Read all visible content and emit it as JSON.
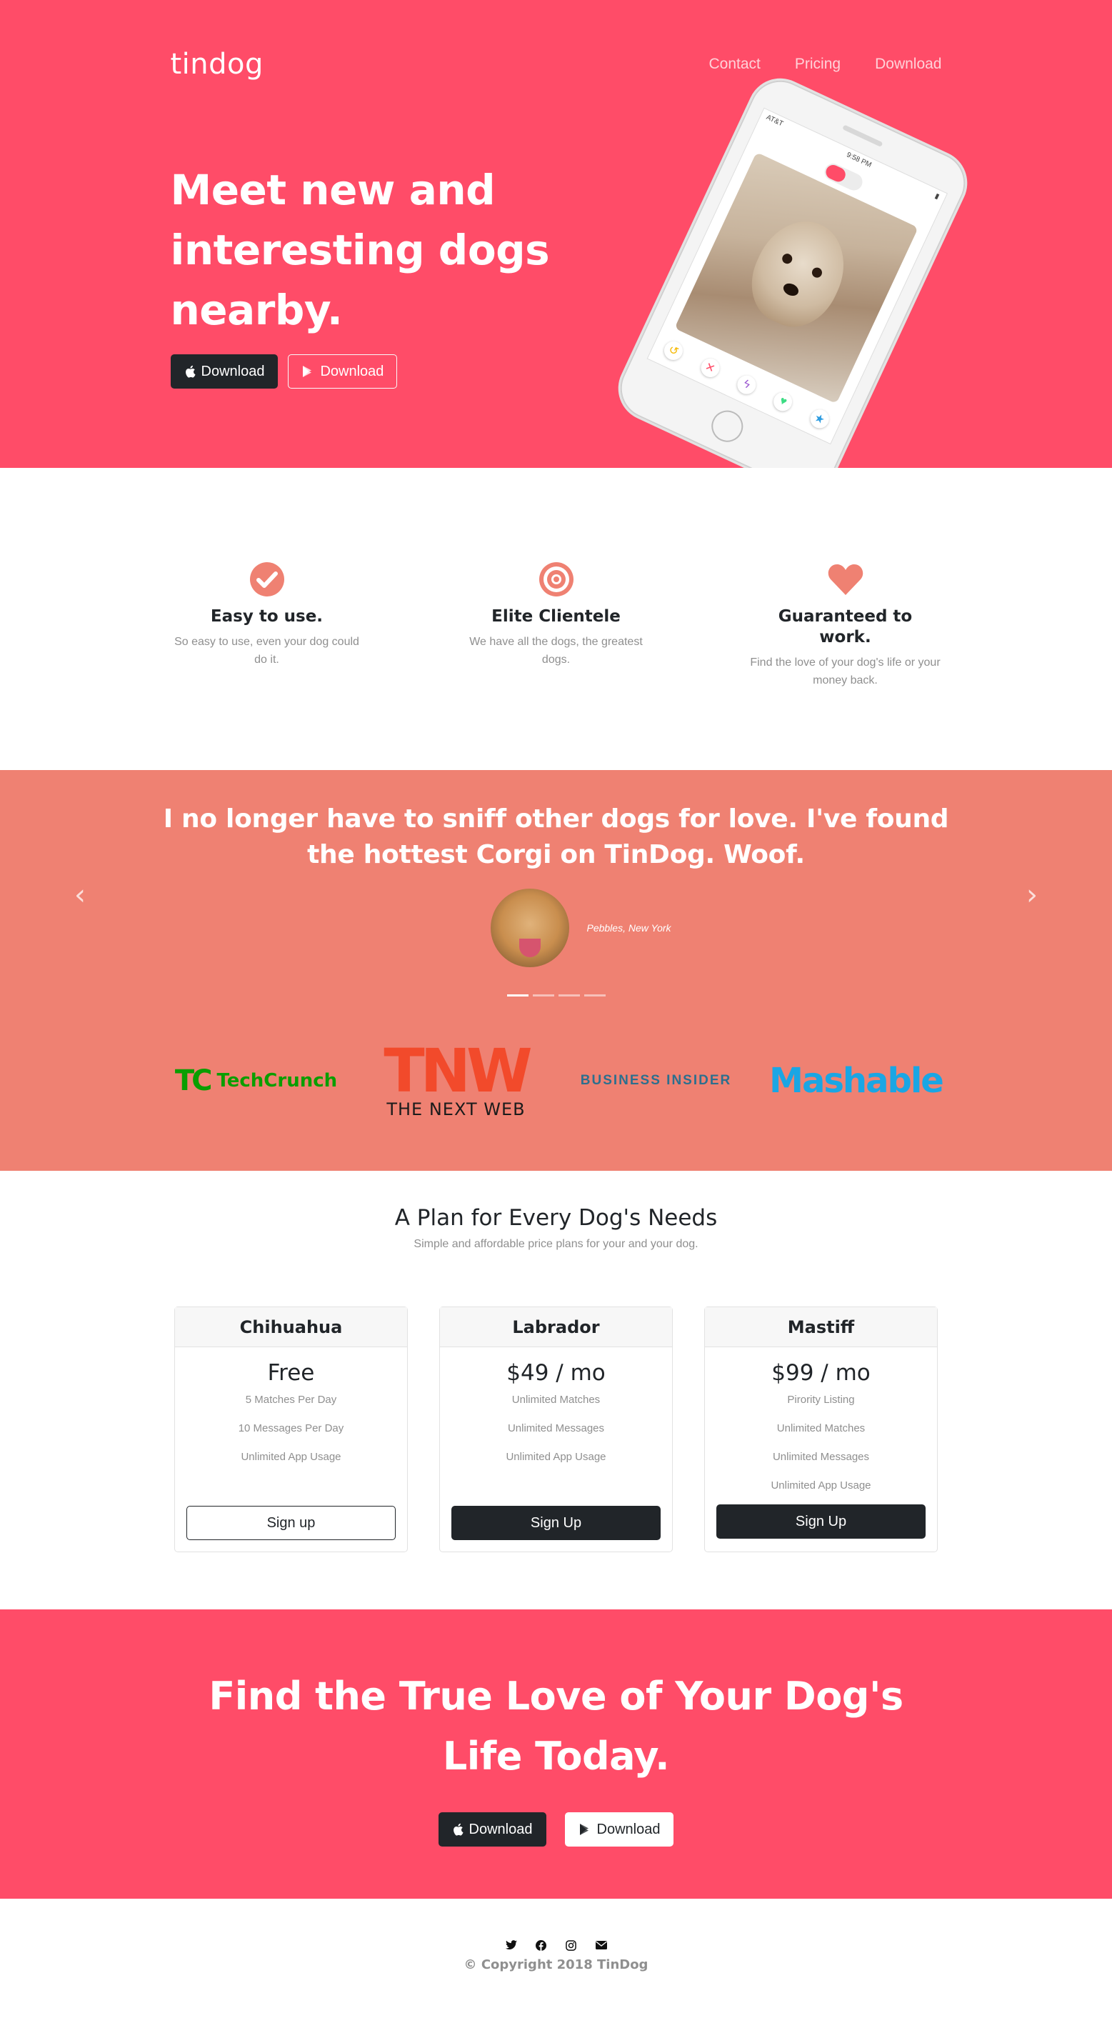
{
  "navbar": {
    "brand": "tindog",
    "links": [
      "Contact",
      "Pricing",
      "Download"
    ]
  },
  "hero": {
    "heading": "Meet new and interesting dogs nearby.",
    "buttons": [
      {
        "label": "Download",
        "icon": "apple-icon"
      },
      {
        "label": "Download",
        "icon": "google-play-icon"
      }
    ],
    "phone": {
      "status_time": "9:58 PM",
      "carrier": "AT&T"
    }
  },
  "features": [
    {
      "icon": "check-circle-icon",
      "title": "Easy to use.",
      "text": "So easy to use, even your dog could do it."
    },
    {
      "icon": "bullseye-icon",
      "title": "Elite Clientele",
      "text": "We have all the dogs, the greatest dogs."
    },
    {
      "icon": "heart-icon",
      "title": "Guaranteed to work.",
      "text": "Find the love of your dog's life or your money back."
    }
  ],
  "testimonial": {
    "quote": "I no longer have to sniff other dogs for love. I've found the hottest Corgi on TinDog. Woof.",
    "author": "Pebbles, New York",
    "indicators": 4,
    "active_indicator": 0
  },
  "press": {
    "techcrunch": {
      "mark": "TC",
      "text": "TechCrunch"
    },
    "tnw": {
      "mark": "TNW",
      "text": "THE NEXT WEB"
    },
    "business_insider": "BUSINESS INSIDER",
    "mashable": "Mashable"
  },
  "pricing": {
    "heading": "A Plan for Every Dog's Needs",
    "subheading": "Simple and affordable price plans for your and your dog.",
    "plans": [
      {
        "name": "Chihuahua",
        "price": "Free",
        "features": [
          "5 Matches Per Day",
          "10 Messages Per Day",
          "Unlimited App Usage"
        ],
        "button": "Sign up"
      },
      {
        "name": "Labrador",
        "price": "$49 / mo",
        "features": [
          "Unlimited Matches",
          "Unlimited Messages",
          "Unlimited App Usage"
        ],
        "button": "Sign Up"
      },
      {
        "name": "Mastiff",
        "price": "$99 / mo",
        "features": [
          "Pirority Listing",
          "Unlimited Matches",
          "Unlimited Messages",
          "Unlimited App Usage"
        ],
        "button": "Sign Up"
      }
    ]
  },
  "cta": {
    "heading": "Find the True Love of Your Dog's Life Today.",
    "buttons": [
      {
        "label": "Download",
        "icon": "apple-icon"
      },
      {
        "label": "Download",
        "icon": "google-play-icon"
      }
    ]
  },
  "footer": {
    "social_icons": [
      "twitter-icon",
      "facebook-icon",
      "instagram-icon",
      "envelope-icon"
    ],
    "copyright": "© Copyright 2018 TinDog"
  },
  "colors": {
    "hero_bg": "#ff4c68",
    "testimonial_bg": "#ef8172",
    "dark_button": "#212529",
    "feature_icon": "#ef8172"
  }
}
